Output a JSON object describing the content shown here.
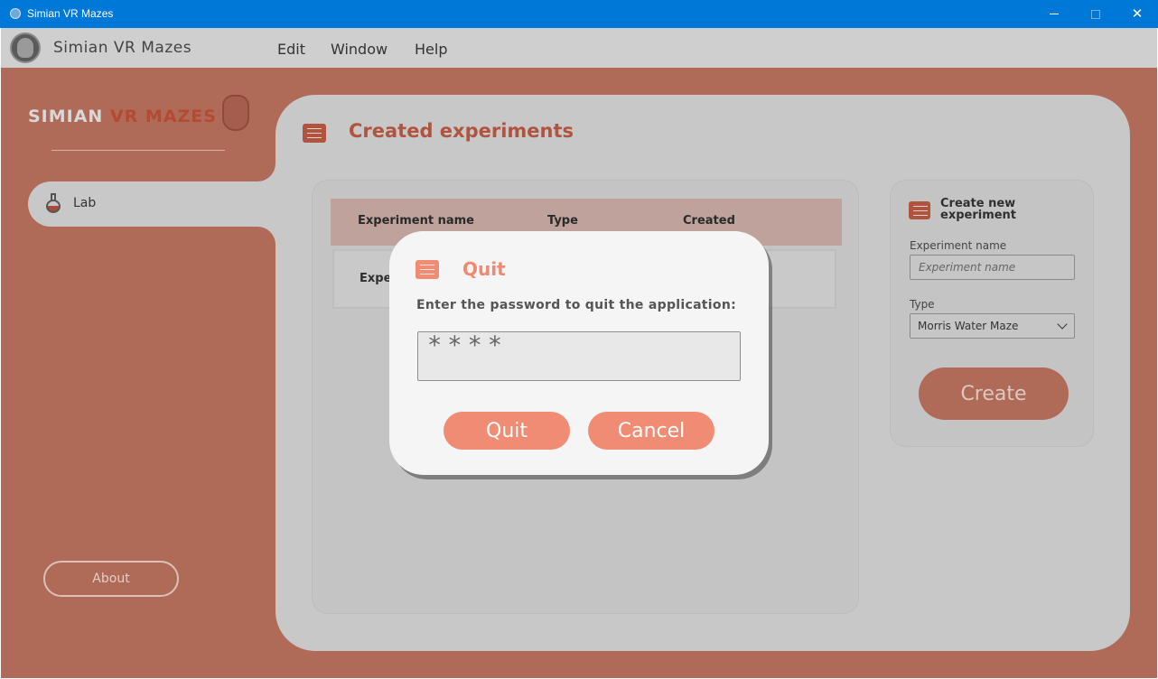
{
  "window": {
    "title": "Simian VR Mazes",
    "controls": {
      "minimize_icon": "minimize-icon",
      "maximize_icon": "maximize-icon",
      "close_icon": "close-icon",
      "close_glyph": "✕"
    }
  },
  "menubar": {
    "app_name": "Simian VR Mazes",
    "menus": [
      "Edit",
      "Window",
      "Help"
    ]
  },
  "sidebar": {
    "brand_plain": "SIMIAN",
    "brand_accent": "VR MAZES",
    "items": [
      {
        "label": "Lab",
        "icon": "flask-icon"
      }
    ],
    "about_label": "About"
  },
  "main": {
    "title": "Created experiments",
    "table": {
      "columns": [
        "Experiment name",
        "Type",
        "Created"
      ],
      "rows": [
        {
          "name": "Expe"
        }
      ]
    }
  },
  "create_panel": {
    "title": "Create new experiment",
    "name_label": "Experiment name",
    "name_placeholder": "Experiment name",
    "type_label": "Type",
    "type_value": "Morris Water Maze",
    "create_label": "Create"
  },
  "dialog": {
    "title": "Quit",
    "prompt": "Enter the password to quit the application:",
    "password_value": "****",
    "quit_label": "Quit",
    "cancel_label": "Cancel"
  },
  "colors": {
    "titlebar": "#0078d7",
    "accent": "#f08c73",
    "overlay_main": "#b06a58",
    "dialog_bg": "#f5f5f5"
  }
}
